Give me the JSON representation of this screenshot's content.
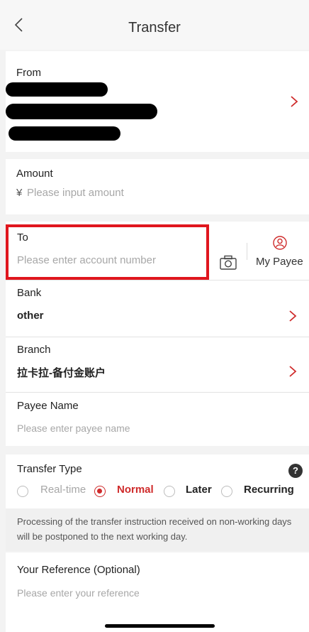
{
  "header": {
    "title": "Transfer"
  },
  "from": {
    "label": "From"
  },
  "amount": {
    "label": "Amount",
    "currency": "¥",
    "placeholder": "Please input amount"
  },
  "to": {
    "label": "To",
    "placeholder": "Please enter account number",
    "my_payee": "My Payee"
  },
  "bank": {
    "label": "Bank",
    "value": "other"
  },
  "branch": {
    "label": "Branch",
    "value": "拉卡拉-备付金账户"
  },
  "payee_name": {
    "label": "Payee Name",
    "placeholder": "Please enter payee name"
  },
  "transfer_type": {
    "label": "Transfer Type",
    "options": [
      {
        "label": "Real-time",
        "selected": false
      },
      {
        "label": "Normal",
        "selected": true
      },
      {
        "label": "Later",
        "selected": false
      },
      {
        "label": "Recurring",
        "selected": false
      }
    ],
    "help_symbol": "?"
  },
  "notice": {
    "text": "Processing of the transfer instruction received on non-working days will be postponed to the next working day."
  },
  "reference": {
    "label": "Your Reference (Optional)",
    "placeholder": "Please enter your reference"
  },
  "colors": {
    "accent": "#cf2b2b",
    "highlight": "#e0161e"
  }
}
